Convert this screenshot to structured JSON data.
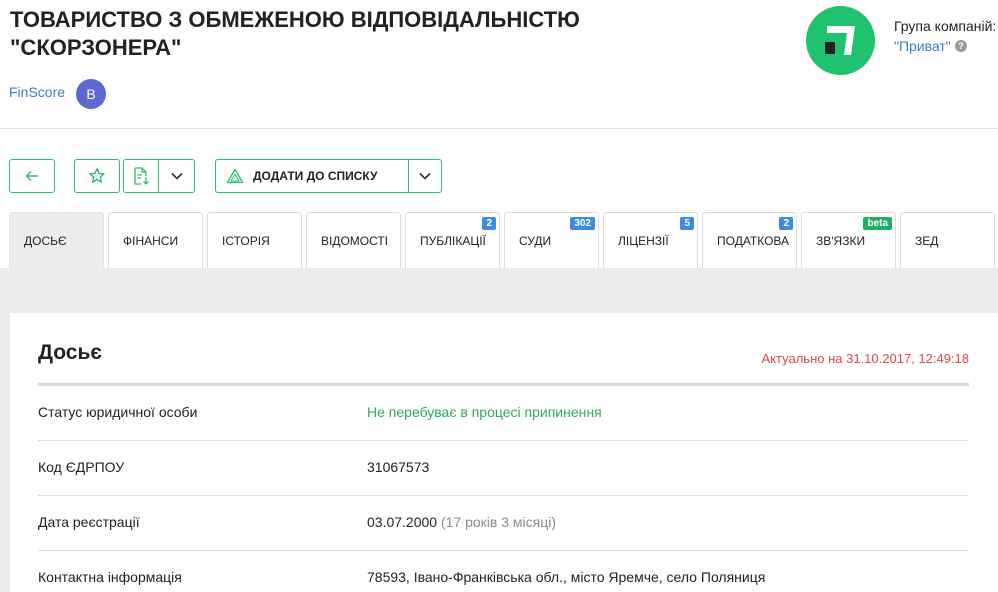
{
  "company": {
    "title_line1": "ТОВАРИСТВО З ОБМЕЖЕНОЮ ВІДПОВІДАЛЬНІСТЮ",
    "title_line2": "\"СКОРЗОНЕРА\"",
    "finscore_label": "FinScore",
    "finscore_grade": "B"
  },
  "group": {
    "label": "Група компаній:",
    "name": "\"Приват\"",
    "help": "?"
  },
  "colors": {
    "accent": "#2ebd6a",
    "logo": "#1fc36f",
    "link": "#3b7bd1",
    "alert": "#e0474c",
    "badge_blue": "#3a8de0",
    "badge_green": "#1fb065"
  },
  "toolbar": {
    "back_icon": "arrow-left-icon",
    "star_icon": "star-icon",
    "export_icon": "file-download-icon",
    "add_to_list_label": "ДОДАТИ ДО СПИСКУ"
  },
  "tabs": [
    {
      "label": "ДОСЬЄ",
      "badge": ""
    },
    {
      "label": "ФІНАНСИ",
      "badge": ""
    },
    {
      "label": "ІСТОРІЯ",
      "badge": ""
    },
    {
      "label": "ВІДОМОСТІ",
      "badge": ""
    },
    {
      "label": "ПУБЛІКАЦІЇ",
      "badge": "2"
    },
    {
      "label": "СУДИ",
      "badge": "302"
    },
    {
      "label": "ЛІЦЕНЗІЇ",
      "badge": "5"
    },
    {
      "label": "ПОДАТКОВА",
      "badge": "2"
    },
    {
      "label": "ЗВ'ЯЗКИ",
      "badge": "beta"
    },
    {
      "label": "ЗЕД",
      "badge": ""
    }
  ],
  "dossier": {
    "title": "Досьє",
    "updated": "Актуально на 31.10.2017, 12:49:18",
    "rows": [
      {
        "label": "Статус юридичної особи",
        "value": "Не перебуває в процесі припинення",
        "extra": ""
      },
      {
        "label": "Код ЄДРПОУ",
        "value": "31067573",
        "extra": ""
      },
      {
        "label": "Дата реєстрації",
        "value": "03.07.2000",
        "extra": "(17 років 3 місяці)"
      },
      {
        "label": "Контактна інформація",
        "value": "78593, Івано-Франківська обл., місто Яремче, село Поляниця",
        "extra": ""
      }
    ]
  }
}
